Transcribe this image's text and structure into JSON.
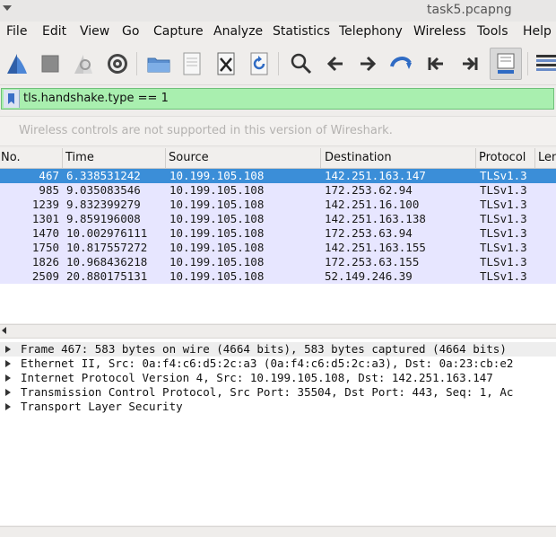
{
  "window": {
    "title": "task5.pcapng"
  },
  "menu": [
    "File",
    "Edit",
    "View",
    "Go",
    "Capture",
    "Analyze",
    "Statistics",
    "Telephony",
    "Wireless",
    "Tools",
    "Help"
  ],
  "toolbar": {
    "icons": [
      "shark-fin-start-icon",
      "stop-icon",
      "restart-icon",
      "options-gear-icon",
      "open-folder-icon",
      "save-file-icon",
      "close-file-icon",
      "reload-icon",
      "search-icon",
      "back-arrow-icon",
      "forward-arrow-icon",
      "go-to-packet-icon",
      "first-packet-icon",
      "last-packet-icon",
      "autoscroll-icon",
      "colorize-icon"
    ]
  },
  "filter": {
    "value": "tls.handshake.type == 1"
  },
  "wireless_notice": "Wireless controls are not supported in this version of Wireshark.",
  "packet_list": {
    "columns": [
      "No.",
      "Time",
      "Source",
      "Destination",
      "Protocol",
      "Len"
    ],
    "rows": [
      {
        "no": "467",
        "time": "6.338531242",
        "src": "10.199.105.108",
        "dst": "142.251.163.147",
        "proto": "TLSv1.3"
      },
      {
        "no": "985",
        "time": "9.035083546",
        "src": "10.199.105.108",
        "dst": "172.253.62.94",
        "proto": "TLSv1.3"
      },
      {
        "no": "1239",
        "time": "9.832399279",
        "src": "10.199.105.108",
        "dst": "142.251.16.100",
        "proto": "TLSv1.3"
      },
      {
        "no": "1301",
        "time": "9.859196008",
        "src": "10.199.105.108",
        "dst": "142.251.163.138",
        "proto": "TLSv1.3"
      },
      {
        "no": "1470",
        "time": "10.002976111",
        "src": "10.199.105.108",
        "dst": "172.253.63.94",
        "proto": "TLSv1.3"
      },
      {
        "no": "1750",
        "time": "10.817557272",
        "src": "10.199.105.108",
        "dst": "142.251.163.155",
        "proto": "TLSv1.3"
      },
      {
        "no": "1826",
        "time": "10.968436218",
        "src": "10.199.105.108",
        "dst": "172.253.63.155",
        "proto": "TLSv1.3"
      },
      {
        "no": "2509",
        "time": "20.880175131",
        "src": "10.199.105.108",
        "dst": "52.149.246.39",
        "proto": "TLSv1.3"
      }
    ]
  },
  "details": [
    "Frame 467: 583 bytes on wire (4664 bits), 583 bytes captured (4664 bits)",
    "Ethernet II, Src: 0a:f4:c6:d5:2c:a3 (0a:f4:c6:d5:2c:a3), Dst: 0a:23:cb:e2",
    "Internet Protocol Version 4, Src: 10.199.105.108, Dst: 142.251.163.147",
    "Transmission Control Protocol, Src Port: 35504, Dst Port: 443, Seq: 1, Ac",
    "Transport Layer Security"
  ]
}
